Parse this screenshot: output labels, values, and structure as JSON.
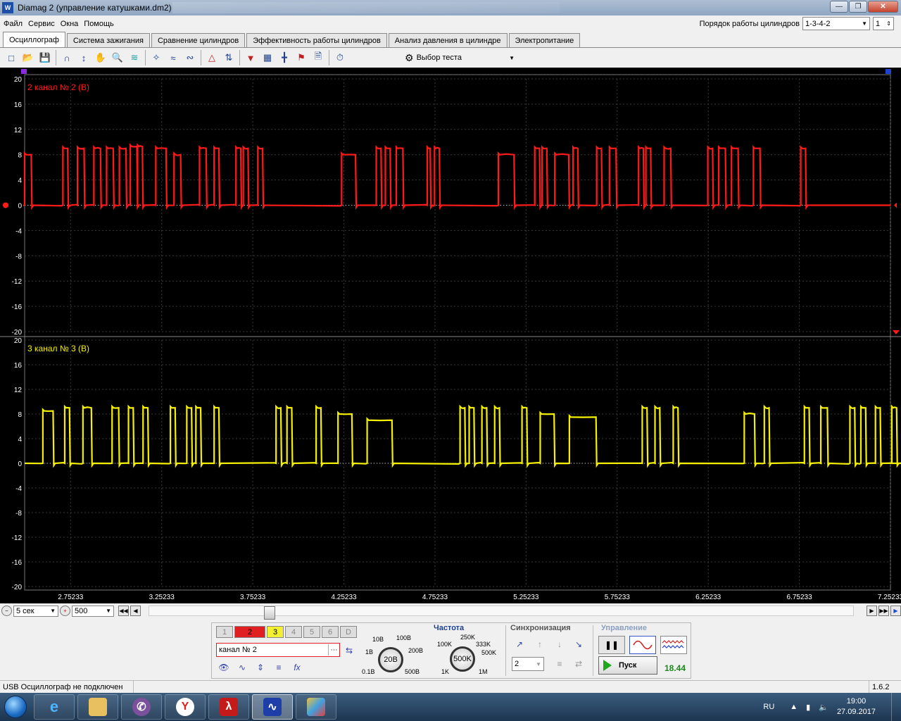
{
  "window": {
    "title": "Diamag 2 (управление катушками.dm2)",
    "app_icon": "diamag-logo-icon",
    "buttons": [
      "minimize",
      "maximize",
      "close"
    ]
  },
  "menu": {
    "items": [
      "Файл",
      "Сервис",
      "Окна",
      "Помощь"
    ]
  },
  "cylinder_order": {
    "label": "Порядок работы цилиндров",
    "value": "1-3-4-2",
    "cylinder": "1"
  },
  "tabs": [
    {
      "label": "Осциллограф",
      "active": true
    },
    {
      "label": "Система зажигания",
      "active": false
    },
    {
      "label": "Сравнение цилиндров",
      "active": false
    },
    {
      "label": "Эффективность работы цилиндров",
      "active": false
    },
    {
      "label": "Анализ давления в цилиндре",
      "active": false
    },
    {
      "label": "Электропитание",
      "active": false
    }
  ],
  "toolbar": {
    "test_select": "Выбор теста"
  },
  "scope": {
    "background": "#000000",
    "grid_color": "#3a3a3a",
    "y_ticks": [
      "20",
      "16",
      "12",
      "8",
      "4",
      "0",
      "-4",
      "-8",
      "-12",
      "-16",
      "-20"
    ],
    "x_ticks": [
      "2.75233",
      "3.25233",
      "3.75233",
      "4.25233",
      "4.75233",
      "5.25233",
      "5.75233",
      "6.25233",
      "6.75233",
      "7.25233"
    ],
    "channels": [
      {
        "name": "2 канал № 2 (В)",
        "color": "#ff1a1a",
        "high_level": 8
      },
      {
        "name": "3 канал № 3 (В)",
        "color": "#f5f000",
        "high_level": 8
      }
    ]
  },
  "chart_data": [
    {
      "type": "line",
      "title": "2 канал № 2 (В)",
      "ylim": [
        -20,
        20
      ],
      "x_ticks": [
        "2.75233",
        "3.25233",
        "3.75233",
        "4.25233",
        "4.75233",
        "5.25233",
        "5.75233",
        "6.25233",
        "6.75233",
        "7.25233"
      ],
      "series": [
        {
          "name": "2 канал № 2 (В)",
          "color": "#ff1a1a",
          "pulses": [
            [
              2.5,
              2.54,
              8
            ],
            [
              2.71,
              2.74,
              9
            ],
            [
              2.79,
              2.83,
              9
            ],
            [
              2.88,
              2.92,
              9
            ],
            [
              2.95,
              2.99,
              9
            ],
            [
              3.02,
              3.06,
              9
            ],
            [
              3.08,
              3.12,
              9.3
            ],
            [
              3.12,
              3.15,
              9.3
            ],
            [
              3.22,
              3.28,
              9
            ],
            [
              3.32,
              3.36,
              8
            ],
            [
              3.46,
              3.5,
              9
            ],
            [
              3.54,
              3.57,
              9
            ],
            [
              3.66,
              3.69,
              9
            ],
            [
              3.7,
              3.73,
              9
            ],
            [
              3.78,
              3.81,
              9
            ],
            [
              4.24,
              4.32,
              8
            ],
            [
              4.43,
              4.46,
              9
            ],
            [
              4.48,
              4.51,
              9
            ],
            [
              4.54,
              4.58,
              9
            ],
            [
              4.71,
              4.73,
              9
            ],
            [
              4.75,
              4.78,
              9
            ],
            [
              5.1,
              5.19,
              8
            ],
            [
              5.3,
              5.33,
              9
            ],
            [
              5.34,
              5.37,
              9
            ],
            [
              5.41,
              5.49,
              8
            ],
            [
              5.51,
              5.54,
              9
            ],
            [
              5.64,
              5.67,
              9
            ],
            [
              5.71,
              5.75,
              9
            ],
            [
              5.87,
              5.9,
              9
            ],
            [
              5.91,
              5.94,
              9
            ],
            [
              6.01,
              6.05,
              9
            ],
            [
              6.25,
              6.28,
              9
            ],
            [
              6.31,
              6.35,
              9
            ],
            [
              6.38,
              6.42,
              9
            ],
            [
              6.5,
              6.54,
              9
            ],
            [
              6.76,
              6.79,
              9
            ]
          ],
          "baseline": 0
        }
      ]
    },
    {
      "type": "line",
      "title": "3 канал № 3 (В)",
      "ylim": [
        -20,
        20
      ],
      "x_ticks": [
        "2.75233",
        "3.25233",
        "3.75233",
        "4.25233",
        "4.75233",
        "5.25233",
        "5.75233",
        "6.25233",
        "6.75233",
        "7.25233"
      ],
      "series": [
        {
          "name": "3 канал № 3 (В)",
          "color": "#f5f000",
          "pulses": [
            [
              2.6,
              2.66,
              8.5
            ],
            [
              2.72,
              2.75,
              9
            ],
            [
              2.82,
              2.87,
              9
            ],
            [
              2.98,
              3.02,
              9
            ],
            [
              3.07,
              3.1,
              9
            ],
            [
              3.15,
              3.18,
              9
            ],
            [
              3.3,
              3.33,
              9
            ],
            [
              3.39,
              3.42,
              9
            ],
            [
              3.44,
              3.47,
              9
            ],
            [
              3.54,
              3.57,
              9
            ],
            [
              3.88,
              3.91,
              9
            ],
            [
              3.94,
              3.97,
              9
            ],
            [
              4.1,
              4.13,
              9
            ],
            [
              4.22,
              4.3,
              8
            ],
            [
              4.38,
              4.52,
              7
            ],
            [
              4.89,
              4.92,
              9
            ],
            [
              4.94,
              4.97,
              9
            ],
            [
              5.01,
              5.04,
              9
            ],
            [
              5.08,
              5.11,
              9
            ],
            [
              5.23,
              5.26,
              9
            ],
            [
              5.33,
              5.41,
              8
            ],
            [
              5.49,
              5.64,
              7.5
            ],
            [
              5.89,
              5.92,
              9
            ],
            [
              5.96,
              5.99,
              9
            ],
            [
              6.06,
              6.09,
              9
            ],
            [
              6.45,
              6.51,
              8
            ],
            [
              6.56,
              6.59,
              9
            ],
            [
              6.78,
              6.81,
              9
            ],
            [
              6.87,
              6.91,
              9
            ],
            [
              7.03,
              7.06,
              9
            ],
            [
              7.09,
              7.12,
              9
            ],
            [
              7.17,
              7.2,
              9
            ],
            [
              7.26,
              7.29,
              9
            ],
            [
              7.36,
              7.39,
              9
            ]
          ],
          "baseline": 0
        }
      ]
    }
  ],
  "scroll": {
    "time_value": "5 сек",
    "points_value": "500"
  },
  "panel": {
    "channel_buttons": [
      "1",
      "2",
      "3",
      "4",
      "5",
      "6",
      "D"
    ],
    "channel_name": "канал № 2",
    "voltage": {
      "value": "20В",
      "labels": [
        "10В",
        "100В",
        "1В",
        "200В",
        "0.1В",
        "500В"
      ]
    },
    "frequency": {
      "title": "Частота",
      "value": "500K",
      "labels": [
        "250K",
        "100K",
        "333K",
        "500K",
        "1K",
        "1M"
      ]
    },
    "sync": {
      "title": "Синхронизация",
      "value": "2"
    },
    "control": {
      "title": "Управление",
      "run_label": "Пуск",
      "counter": "18.44"
    }
  },
  "status": {
    "message": "USB Осциллограф не подключен",
    "version": "1.6.2"
  },
  "taskbar": {
    "apps": [
      "ie",
      "explorer",
      "viber",
      "yandex",
      "pdf",
      "diamag",
      "paint"
    ],
    "lang": "RU",
    "time": "19:00",
    "date": "27.09.2017"
  }
}
